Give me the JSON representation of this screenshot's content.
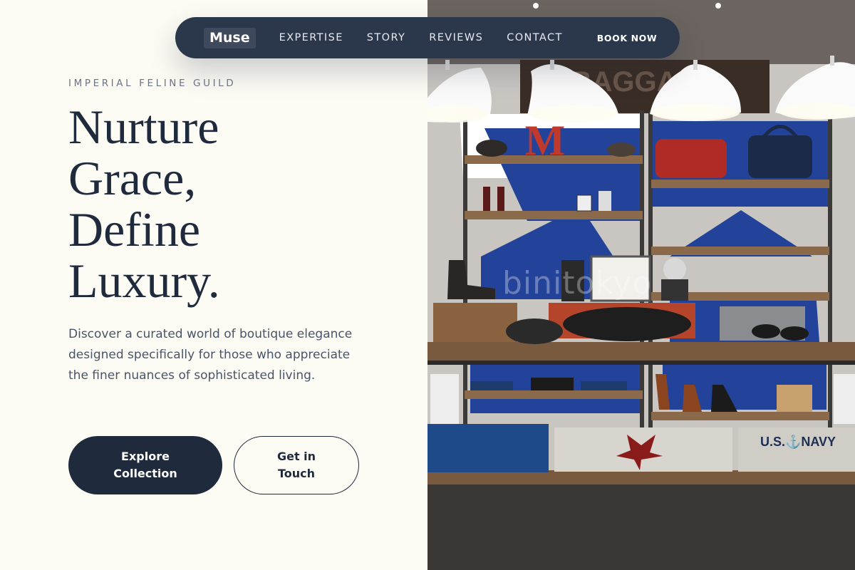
{
  "nav": {
    "brand": "Muse",
    "links": [
      "EXPERTISE",
      "STORY",
      "REVIEWS",
      "CONTACT"
    ],
    "cta": "BOOK NOW"
  },
  "hero": {
    "eyebrow": "IMPERIAL FELINE GUILD",
    "headline": [
      "Nurture",
      "Grace,",
      "Define",
      "Luxury."
    ],
    "lede": "Discover a curated world of boutique elegance designed specifically for those who appreciate the finer nuances of sophisticated living.",
    "primary_cta": [
      "Explore",
      "Collection"
    ],
    "secondary_cta": [
      "Get in",
      "Touch"
    ]
  },
  "photo": {
    "watermark": "binitokyo",
    "sign_text": "BAGGAGE",
    "letter": "M",
    "shirt_text": "U.S.⚓NAVY"
  },
  "colors": {
    "background": "#fcfbf4",
    "navy": "#1f2a3c",
    "nav_bg": "#2b384b",
    "accent_blue": "#1d4a9c"
  }
}
